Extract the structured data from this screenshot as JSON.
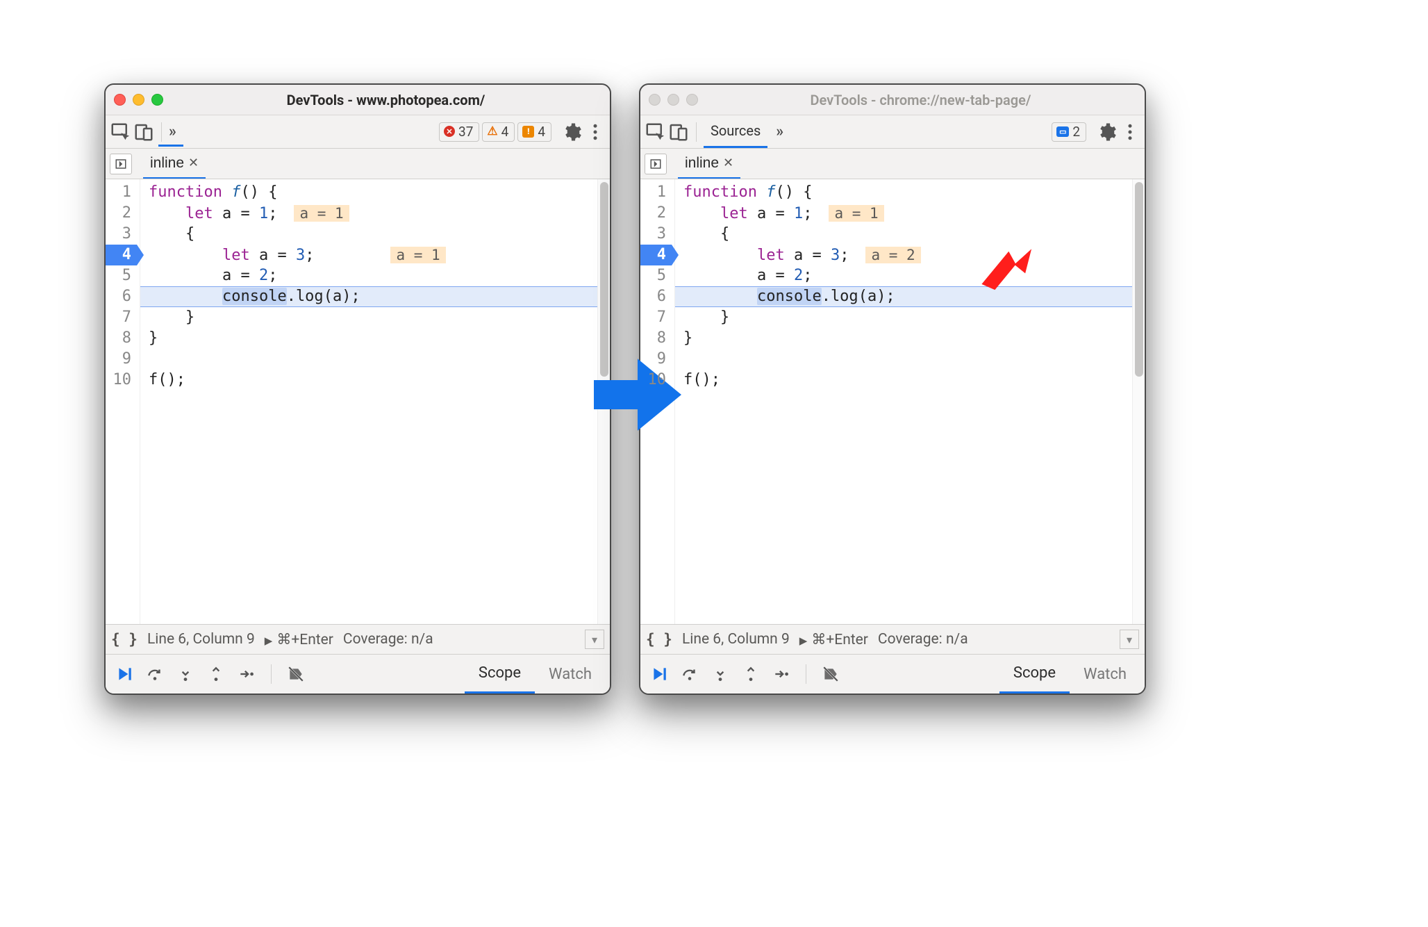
{
  "arrow_color": "#1273eb",
  "red_color": "#ff1e1c",
  "windows": {
    "left": {
      "title": "DevTools - www.photopea.com/",
      "active": true,
      "toolbar_tab": "",
      "badges": {
        "errors": "37",
        "warnings": "4",
        "violations": "4"
      },
      "source_tab": "inline",
      "status_line": "Line 6, Column 9",
      "status_enter": "⌘+Enter",
      "status_cov": "Coverage: n/a",
      "pane_scope": "Scope",
      "pane_watch": "Watch",
      "gutter": [
        "1",
        "2",
        "3",
        "4",
        "5",
        "6",
        "7",
        "8",
        "9",
        "10"
      ],
      "bp_line": 4,
      "exec_line": 6,
      "annots": {
        "l2": "a = 1",
        "l4": "a = 1"
      }
    },
    "right": {
      "title": "DevTools - chrome://new-tab-page/",
      "active": false,
      "toolbar_tab": "Sources",
      "badges": {
        "messages": "2"
      },
      "source_tab": "inline",
      "status_line": "Line 6, Column 9",
      "status_enter": "⌘+Enter",
      "status_cov": "Coverage: n/a",
      "pane_scope": "Scope",
      "pane_watch": "Watch",
      "gutter": [
        "1",
        "2",
        "3",
        "4",
        "5",
        "6",
        "7",
        "8",
        "9",
        "10"
      ],
      "bp_line": 4,
      "exec_line": 6,
      "annots": {
        "l2": "a = 1",
        "l4": "a = 2"
      }
    }
  },
  "code": {
    "kw_function": "function",
    "fn_name": "f",
    "kw_let": "let",
    "var_a": "a",
    "n1": "1",
    "n2": "2",
    "n3": "3",
    "console": "console",
    "log": "log",
    "call": "f();"
  }
}
